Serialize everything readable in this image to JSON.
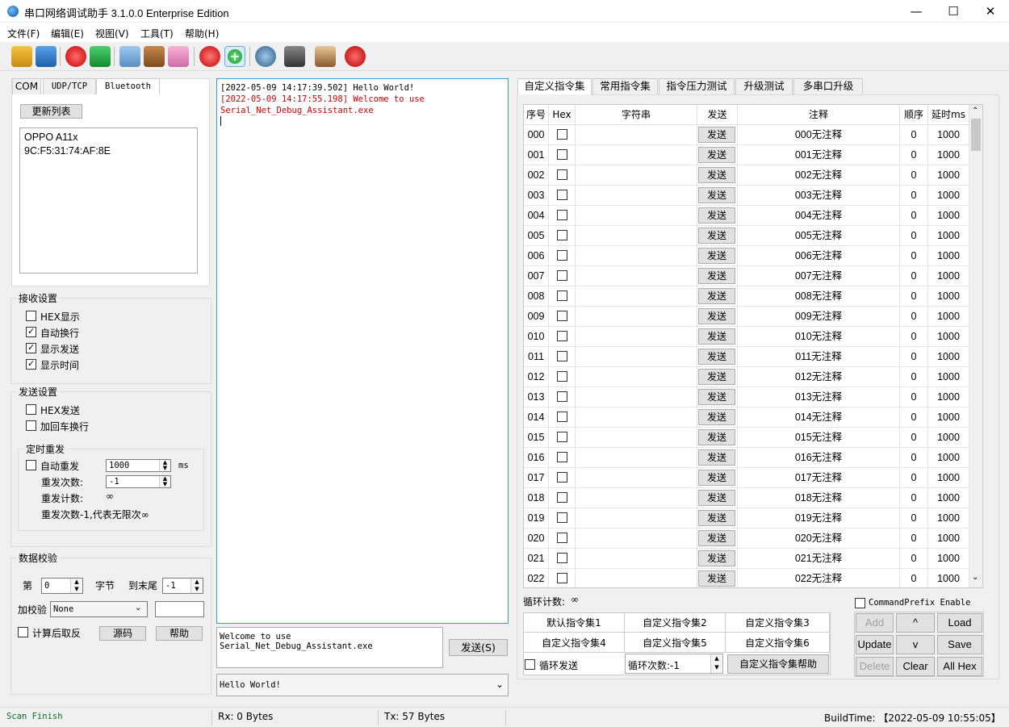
{
  "window": {
    "title": "串口网络调试助手 3.1.0.0 Enterprise Edition",
    "min": "—",
    "max": "☐",
    "close": "✕"
  },
  "menu": [
    "文件(F)",
    "编辑(E)",
    "视图(V)",
    "工具(T)",
    "帮助(H)"
  ],
  "conn_tabs": [
    "COM",
    "UDP/TCP",
    "Bluetooth"
  ],
  "bluetooth": {
    "refresh": "更新列表",
    "devices": [
      "OPPO A11x",
      "9C:F5:31:74:AF:8E"
    ]
  },
  "recv": {
    "title": "接收设置",
    "options": [
      {
        "label": "HEX显示",
        "checked": false
      },
      {
        "label": "自动换行",
        "checked": true
      },
      {
        "label": "显示发送",
        "checked": true
      },
      {
        "label": "显示时间",
        "checked": true
      }
    ]
  },
  "send": {
    "title": "发送设置",
    "options": [
      {
        "label": "HEX发送",
        "checked": false
      },
      {
        "label": "加回车换行",
        "checked": false
      }
    ],
    "timer": {
      "title": "定时重发",
      "auto_label": "自动重发",
      "interval": "1000",
      "unit": "ms",
      "count_label": "重发次数:",
      "count": "-1",
      "counter_label": "重发计数:",
      "counter": "∞",
      "note": "重发次数-1,代表无限次∞"
    }
  },
  "checksum": {
    "title": "数据校验",
    "first": "第",
    "start": "0",
    "byte": "字节",
    "to_end": "到末尾",
    "end": "-1",
    "add_label": "加校验",
    "method": "None",
    "calc_label": "计算后取反",
    "source_btn": "源码",
    "help_btn": "帮助"
  },
  "log": [
    {
      "text": "[2022-05-09 14:17:39.502] Hello World!",
      "color": "#000000"
    },
    {
      "text": "[2022-05-09 14:17:55.198] Welcome to use Serial_Net_Debug_Assistant.exe",
      "color": "#cc0000"
    }
  ],
  "send_box": {
    "text": "Welcome to use Serial_Net_Debug_Assistant.exe",
    "send_btn": "发送(S)",
    "history": "Hello World!"
  },
  "right_tabs": [
    "自定义指令集",
    "常用指令集",
    "指令压力测试",
    "升级测试",
    "多串口升级"
  ],
  "table": {
    "headers": [
      "序号",
      "Hex",
      "字符串",
      "发送",
      "注释",
      "顺序",
      "延时ms"
    ],
    "send_label": "发送",
    "rows": [
      {
        "id": "000",
        "note": "000无注释",
        "order": "0",
        "delay": "1000"
      },
      {
        "id": "001",
        "note": "001无注释",
        "order": "0",
        "delay": "1000"
      },
      {
        "id": "002",
        "note": "002无注释",
        "order": "0",
        "delay": "1000"
      },
      {
        "id": "003",
        "note": "003无注释",
        "order": "0",
        "delay": "1000"
      },
      {
        "id": "004",
        "note": "004无注释",
        "order": "0",
        "delay": "1000"
      },
      {
        "id": "005",
        "note": "005无注释",
        "order": "0",
        "delay": "1000"
      },
      {
        "id": "006",
        "note": "006无注释",
        "order": "0",
        "delay": "1000"
      },
      {
        "id": "007",
        "note": "007无注释",
        "order": "0",
        "delay": "1000"
      },
      {
        "id": "008",
        "note": "008无注释",
        "order": "0",
        "delay": "1000"
      },
      {
        "id": "009",
        "note": "009无注释",
        "order": "0",
        "delay": "1000"
      },
      {
        "id": "010",
        "note": "010无注释",
        "order": "0",
        "delay": "1000"
      },
      {
        "id": "011",
        "note": "011无注释",
        "order": "0",
        "delay": "1000"
      },
      {
        "id": "012",
        "note": "012无注释",
        "order": "0",
        "delay": "1000"
      },
      {
        "id": "013",
        "note": "013无注释",
        "order": "0",
        "delay": "1000"
      },
      {
        "id": "014",
        "note": "014无注释",
        "order": "0",
        "delay": "1000"
      },
      {
        "id": "015",
        "note": "015无注释",
        "order": "0",
        "delay": "1000"
      },
      {
        "id": "016",
        "note": "016无注释",
        "order": "0",
        "delay": "1000"
      },
      {
        "id": "017",
        "note": "017无注释",
        "order": "0",
        "delay": "1000"
      },
      {
        "id": "018",
        "note": "018无注释",
        "order": "0",
        "delay": "1000"
      },
      {
        "id": "019",
        "note": "019无注释",
        "order": "0",
        "delay": "1000"
      },
      {
        "id": "020",
        "note": "020无注释",
        "order": "0",
        "delay": "1000"
      },
      {
        "id": "021",
        "note": "021无注释",
        "order": "0",
        "delay": "1000"
      },
      {
        "id": "022",
        "note": "022无注释",
        "order": "0",
        "delay": "1000"
      }
    ]
  },
  "loop": {
    "label": "循环计数:",
    "value": "∞",
    "loop_send": "循环发送",
    "loop_count": "循环次数:-1",
    "help": "自定义指令集帮助"
  },
  "sets": [
    "默认指令集1",
    "自定义指令集2",
    "自定义指令集3",
    "自定义指令集4",
    "自定义指令集5",
    "自定义指令集6"
  ],
  "prefix": {
    "label": "CommandPrefix Enable",
    "checked": false
  },
  "actions": [
    {
      "label": "Add",
      "enabled": false
    },
    {
      "label": "^",
      "enabled": true
    },
    {
      "label": "Load",
      "enabled": true
    },
    {
      "label": "Update",
      "enabled": true
    },
    {
      "label": "v",
      "enabled": true
    },
    {
      "label": "Save",
      "enabled": true
    },
    {
      "label": "Delete",
      "enabled": false
    },
    {
      "label": "Clear",
      "enabled": true
    },
    {
      "label": "All Hex",
      "enabled": true
    }
  ],
  "status": {
    "scan": "Scan Finish",
    "rx": "Rx: 0 Bytes",
    "tx": "Tx: 57 Bytes",
    "build": "BuildTime: 【2022-05-09 10:55:05】"
  }
}
